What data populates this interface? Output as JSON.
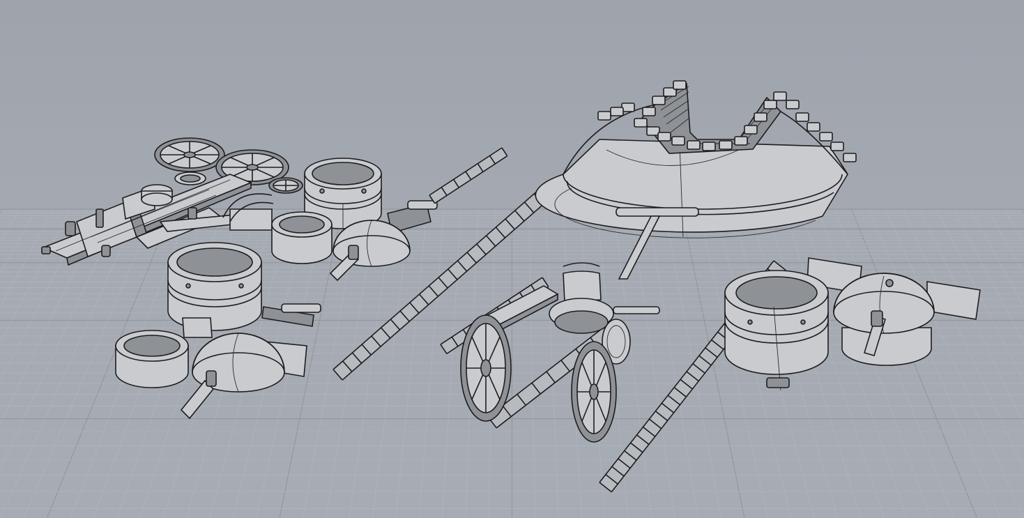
{
  "viewport": {
    "background": "#a4a9b2",
    "grid_color": "#b3b7be",
    "wire_color": "#1d1d1f",
    "surface_color": "#c9cbce"
  },
  "scene": {
    "objects": [
      "spoked-wheels",
      "chassis-assembly",
      "cylinder-tower",
      "ring-segment",
      "dome-turret",
      "ladder",
      "conical-bastion",
      "wagon-with-wheels",
      "ladder-ramp"
    ]
  }
}
